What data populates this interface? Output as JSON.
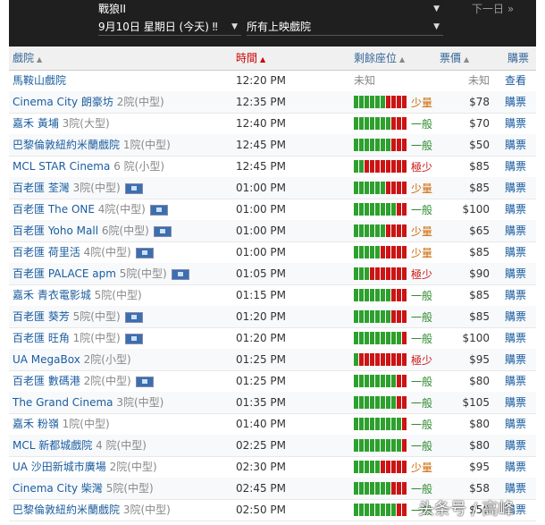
{
  "filters": {
    "movie": "戰狼II",
    "date": "9月10日 星期日 (今天) ‼",
    "cinema": "所有上映戲院",
    "next_day": "下一日 »"
  },
  "columns": {
    "cinema": "戲院",
    "time": "時間",
    "seats": "剩餘座位",
    "price": "票價",
    "buy": "購票"
  },
  "rows": [
    {
      "cinema": "馬鞍山戲院",
      "house": "",
      "time": "12:20 PM",
      "seat_text": "未知",
      "seat_level": "unknown",
      "green": 0,
      "price": "未知",
      "buy": "查看",
      "flag": false
    },
    {
      "cinema": "Cinema City 朗豪坊",
      "house": "2院(中型)",
      "time": "12:35 PM",
      "seat_text": "少量",
      "seat_level": "few",
      "green": 6,
      "price": "$78",
      "buy": "購票",
      "flag": false
    },
    {
      "cinema": "嘉禾 黃埔",
      "house": "3院(大型)",
      "time": "12:40 PM",
      "seat_text": "一般",
      "seat_level": "mid",
      "green": 7,
      "price": "$70",
      "buy": "購票",
      "flag": false
    },
    {
      "cinema": "巴黎倫敦紐約米蘭戲院",
      "house": "1院(中型)",
      "time": "12:45 PM",
      "seat_text": "一般",
      "seat_level": "mid",
      "green": 7,
      "price": "$50",
      "buy": "購票",
      "flag": false
    },
    {
      "cinema": "MCL STAR Cinema",
      "house": "6 院(小型)",
      "time": "12:45 PM",
      "seat_text": "極少",
      "seat_level": "vfew",
      "green": 2,
      "price": "$85",
      "buy": "購票",
      "flag": false
    },
    {
      "cinema": "百老匯 荃灣",
      "house": "3院(中型)",
      "time": "01:00 PM",
      "seat_text": "少量",
      "seat_level": "few",
      "green": 6,
      "price": "$85",
      "buy": "購票",
      "flag": true
    },
    {
      "cinema": "百老匯 The ONE",
      "house": "4院(中型)",
      "time": "01:00 PM",
      "seat_text": "一般",
      "seat_level": "mid",
      "green": 8,
      "price": "$100",
      "buy": "購票",
      "flag": true
    },
    {
      "cinema": "百老匯 Yoho Mall",
      "house": "6院(中型)",
      "time": "01:00 PM",
      "seat_text": "少量",
      "seat_level": "few",
      "green": 6,
      "price": "$65",
      "buy": "購票",
      "flag": true
    },
    {
      "cinema": "百老匯 荷里活",
      "house": "4院(中型)",
      "time": "01:00 PM",
      "seat_text": "少量",
      "seat_level": "few",
      "green": 5,
      "price": "$85",
      "buy": "購票",
      "flag": true
    },
    {
      "cinema": "百老匯 PALACE apm",
      "house": "5院(中型)",
      "time": "01:05 PM",
      "seat_text": "極少",
      "seat_level": "vfew",
      "green": 3,
      "price": "$90",
      "buy": "購票",
      "flag": true
    },
    {
      "cinema": "嘉禾 青衣電影城",
      "house": "5院(中型)",
      "time": "01:15 PM",
      "seat_text": "一般",
      "seat_level": "mid",
      "green": 7,
      "price": "$85",
      "buy": "購票",
      "flag": false
    },
    {
      "cinema": "百老匯 葵芳",
      "house": "5院(中型)",
      "time": "01:20 PM",
      "seat_text": "一般",
      "seat_level": "mid",
      "green": 7,
      "price": "$85",
      "buy": "購票",
      "flag": true
    },
    {
      "cinema": "百老匯 旺角",
      "house": "1院(中型)",
      "time": "01:20 PM",
      "seat_text": "一般",
      "seat_level": "mid",
      "green": 9,
      "price": "$100",
      "buy": "購票",
      "flag": true
    },
    {
      "cinema": "UA MegaBox",
      "house": "2院(小型)",
      "time": "01:25 PM",
      "seat_text": "極少",
      "seat_level": "vfew",
      "green": 1,
      "price": "$95",
      "buy": "購票",
      "flag": false
    },
    {
      "cinema": "百老匯 數碼港",
      "house": "2院(中型)",
      "time": "01:25 PM",
      "seat_text": "一般",
      "seat_level": "mid",
      "green": 8,
      "price": "$80",
      "buy": "購票",
      "flag": true
    },
    {
      "cinema": "The Grand Cinema",
      "house": "3院(中型)",
      "time": "01:35 PM",
      "seat_text": "一般",
      "seat_level": "mid",
      "green": 8,
      "price": "$105",
      "buy": "購票",
      "flag": false
    },
    {
      "cinema": "嘉禾 粉嶺",
      "house": "1院(中型)",
      "time": "01:40 PM",
      "seat_text": "一般",
      "seat_level": "mid",
      "green": 9,
      "price": "$80",
      "buy": "購票",
      "flag": false
    },
    {
      "cinema": "MCL 新都城戲院",
      "house": "4 院(中型)",
      "time": "02:25 PM",
      "seat_text": "一般",
      "seat_level": "mid",
      "green": 9,
      "price": "$80",
      "buy": "購票",
      "flag": false
    },
    {
      "cinema": "UA 沙田新城市廣場",
      "house": "2院(中型)",
      "time": "02:30 PM",
      "seat_text": "少量",
      "seat_level": "few",
      "green": 5,
      "price": "$95",
      "buy": "購票",
      "flag": false
    },
    {
      "cinema": "Cinema City 柴灣",
      "house": "5院(中型)",
      "time": "02:45 PM",
      "seat_text": "一般",
      "seat_level": "mid",
      "green": 7,
      "price": "$58",
      "buy": "購票",
      "flag": false
    },
    {
      "cinema": "巴黎倫敦紐約米蘭戲院",
      "house": "3院(中型)",
      "time": "02:50 PM",
      "seat_text": "一般",
      "seat_level": "mid",
      "green": 8,
      "price": "$50",
      "buy": "購票",
      "flag": false
    }
  ],
  "watermark": "头条号 / 高峰",
  "colors": {
    "green": "#2da02d",
    "red": "#cc1414",
    "link": "#1a5c9e",
    "active_sort": "#cc0000"
  }
}
